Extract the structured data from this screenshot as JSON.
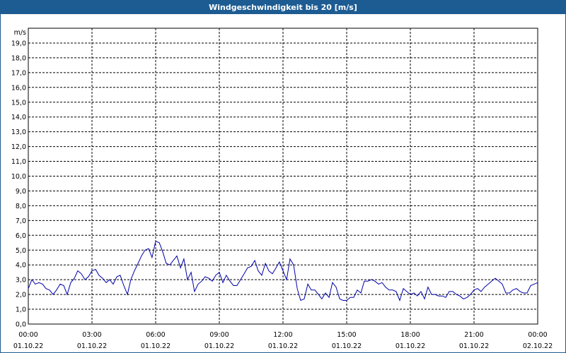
{
  "title": "Windgeschwindigkeit bis 20 [m/s]",
  "chart_data": {
    "type": "line",
    "title": "Windgeschwindigkeit bis 20 [m/s]",
    "ylabel": "m/s",
    "xlabel": "",
    "ylim": [
      0,
      20
    ],
    "y_ticks": [
      "0,0",
      "1,0",
      "2,0",
      "3,0",
      "4,0",
      "5,0",
      "6,0",
      "7,0",
      "8,0",
      "9,0",
      "10,0",
      "11,0",
      "12,0",
      "13,0",
      "14,0",
      "15,0",
      "16,0",
      "17,0",
      "18,0",
      "19,0"
    ],
    "x_ticks": [
      {
        "time": "00:00",
        "date": "01.10.22"
      },
      {
        "time": "03:00",
        "date": "01.10.22"
      },
      {
        "time": "06:00",
        "date": "01.10.22"
      },
      {
        "time": "09:00",
        "date": "01.10.22"
      },
      {
        "time": "12:00",
        "date": "01.10.22"
      },
      {
        "time": "15:00",
        "date": "01.10.22"
      },
      {
        "time": "18:00",
        "date": "01.10.22"
      },
      {
        "time": "21:00",
        "date": "01.10.22"
      },
      {
        "time": "00:00",
        "date": "02.10.22"
      }
    ],
    "grid": true,
    "line_color": "#0000aa",
    "series": [
      {
        "x_hours": [
          0,
          0.17,
          0.33,
          0.5,
          0.67,
          0.83,
          1.0,
          1.17,
          1.33,
          1.5,
          1.67,
          1.83,
          2.0,
          2.17,
          2.33,
          2.5,
          2.67,
          2.83,
          3.0,
          3.17,
          3.33,
          3.5,
          3.67,
          3.83,
          4.0,
          4.17,
          4.33,
          4.5,
          4.67,
          4.83,
          5.0,
          5.17,
          5.33,
          5.5,
          5.67,
          5.83,
          6.0,
          6.17,
          6.33,
          6.5,
          6.67,
          6.83,
          7.0,
          7.17,
          7.33,
          7.5,
          7.67,
          7.83,
          8.0,
          8.17,
          8.33,
          8.5,
          8.67,
          8.83,
          9.0,
          9.17,
          9.33,
          9.5,
          9.67,
          9.83,
          10.0,
          10.17,
          10.33,
          10.5,
          10.67,
          10.83,
          11.0,
          11.17,
          11.33,
          11.5,
          11.67,
          11.83,
          12.0,
          12.17,
          12.33,
          12.5,
          12.67,
          12.83,
          13.0,
          13.17,
          13.33,
          13.5,
          13.67,
          13.83,
          14.0,
          14.17,
          14.33,
          14.5,
          14.67,
          14.83,
          15.0,
          15.17,
          15.33,
          15.5,
          15.67,
          15.83,
          16.0,
          16.17,
          16.33,
          16.5,
          16.67,
          16.83,
          17.0,
          17.17,
          17.33,
          17.5,
          17.67,
          17.83,
          18.0,
          18.17,
          18.33,
          18.5,
          18.67,
          18.83,
          19.0,
          19.17,
          19.33,
          19.5,
          19.67,
          19.83,
          20.0,
          20.17,
          20.33,
          20.5,
          20.67,
          20.83,
          21.0,
          21.17,
          21.33,
          21.5,
          21.67,
          21.83,
          22.0,
          22.17,
          22.33,
          22.5,
          22.67,
          22.83,
          23.0,
          23.17,
          23.33,
          23.5,
          23.67,
          23.83,
          24.0
        ],
        "values": [
          2.4,
          3.0,
          2.7,
          2.8,
          2.7,
          2.4,
          2.3,
          2.0,
          2.3,
          2.7,
          2.6,
          2.0,
          2.8,
          3.1,
          3.6,
          3.4,
          3.0,
          3.2,
          3.6,
          3.7,
          3.3,
          3.1,
          2.8,
          3.0,
          2.7,
          3.2,
          3.3,
          2.6,
          2.0,
          3.0,
          3.6,
          4.1,
          4.6,
          5.0,
          5.1,
          4.5,
          5.6,
          5.5,
          4.9,
          4.1,
          4.0,
          4.3,
          4.6,
          3.8,
          4.4,
          3.0,
          3.5,
          2.2,
          2.7,
          2.9,
          3.2,
          3.1,
          2.9,
          3.3,
          3.5,
          2.8,
          3.3,
          2.9,
          2.6,
          2.6,
          3.0,
          3.4,
          3.8,
          3.9,
          4.3,
          3.6,
          3.3,
          4.1,
          3.6,
          3.4,
          3.8,
          4.2,
          3.6,
          3.0,
          4.4,
          4.0,
          2.4,
          1.6,
          1.7,
          2.7,
          2.3,
          2.3,
          2.0,
          1.7,
          2.1,
          1.8,
          2.8,
          2.5,
          1.7,
          1.6,
          1.6,
          1.8,
          1.8,
          2.3,
          2.1,
          2.9,
          2.9,
          3.0,
          2.9,
          2.7,
          2.8,
          2.5,
          2.3,
          2.3,
          2.2,
          1.6,
          2.4,
          2.2,
          2.0,
          2.1,
          1.9,
          2.2,
          1.7,
          2.5,
          2.0,
          2.0,
          1.9,
          1.9,
          1.8,
          2.2,
          2.2,
          2.0,
          1.9,
          1.7,
          1.8,
          2.0,
          2.3,
          2.4,
          2.2,
          2.5,
          2.7,
          2.9,
          3.1,
          2.9,
          2.7,
          2.1,
          2.1,
          2.3,
          2.4,
          2.2,
          2.1,
          2.1,
          2.6,
          2.7,
          2.8,
          2.7,
          2.9
        ]
      }
    ]
  }
}
